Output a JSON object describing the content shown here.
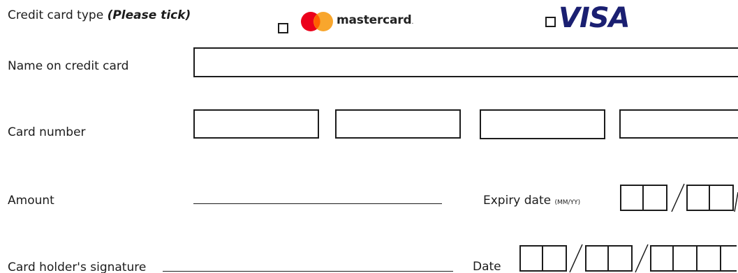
{
  "card_type": {
    "label": "Credit card type",
    "instruction": "(Please tick)",
    "mastercard": "mastercard",
    "visa": "VISA"
  },
  "name_on_card": {
    "label": "Name on credit card"
  },
  "card_number": {
    "label": "Card number"
  },
  "amount": {
    "label": "Amount"
  },
  "expiry": {
    "label": "Expiry date",
    "format_hint": "(MM/YY)"
  },
  "signature": {
    "label": "Card holder's signature"
  },
  "date": {
    "label": "Date"
  },
  "colors": {
    "mastercard_red": "#eb001b",
    "mastercard_orange": "#f79e1b",
    "visa_blue": "#1a1f71"
  }
}
